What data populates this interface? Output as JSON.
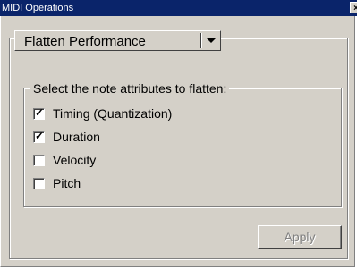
{
  "window": {
    "title": "MIDI Operations",
    "close_glyph": "×"
  },
  "operation_dropdown": {
    "selected": "Flatten Performance"
  },
  "attributes_group": {
    "legend": "Select the note attributes to flatten:",
    "options": [
      {
        "label": "Timing (Quantization)",
        "checked": true
      },
      {
        "label": "Duration",
        "checked": true
      },
      {
        "label": "Velocity",
        "checked": false
      },
      {
        "label": "Pitch",
        "checked": false
      }
    ]
  },
  "footer": {
    "apply_label": "Apply",
    "apply_enabled": false
  },
  "colors": {
    "titlebar": "#0a246a",
    "dialog_face": "#d4d0c8",
    "disabled_text": "#808080"
  },
  "icons": {
    "close": "close-icon",
    "dropdown_arrow": "chevron-down-icon",
    "check": "check-icon"
  }
}
